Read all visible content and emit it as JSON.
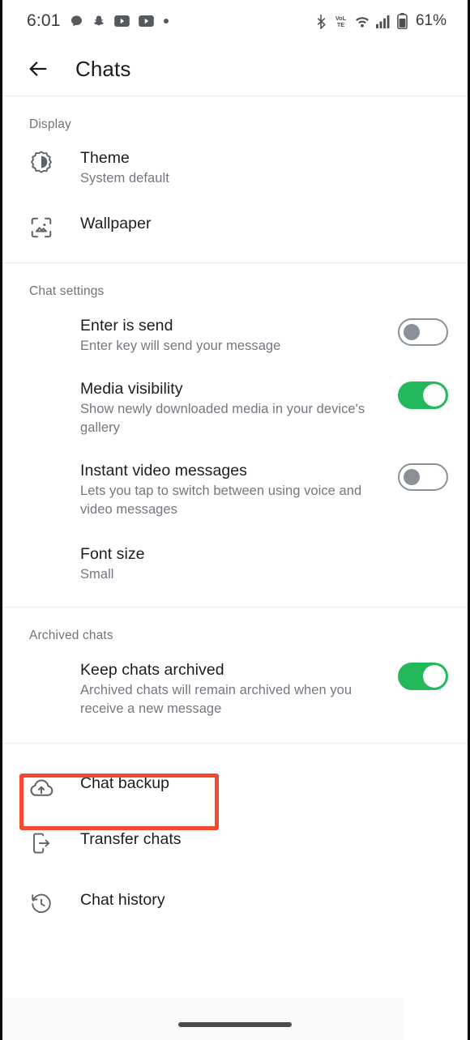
{
  "status_bar": {
    "time": "6:01",
    "battery_percent": "61%",
    "left_icons": [
      "chat-bubble-icon",
      "snapchat-icon",
      "youtube-icon",
      "youtube-icon",
      "dot-icon"
    ],
    "right_icons": [
      "bluetooth-icon",
      "volte-icon",
      "wifi-icon",
      "cellular-signal-icon",
      "battery-icon"
    ]
  },
  "app_bar": {
    "back_icon": "arrow-left-icon",
    "title": "Chats"
  },
  "colors": {
    "toggle_on": "#23b95b",
    "toggle_off": "#8b9199",
    "highlight": "#f04a32",
    "title_text": "#1d1d1d",
    "subtitle_text": "#737880",
    "section_label": "#6f7479"
  },
  "sections": [
    {
      "label": "Display",
      "rows": [
        {
          "icon": "brightness-theme-icon",
          "title": "Theme",
          "subtitle": "System default"
        },
        {
          "icon": "wallpaper-image-icon",
          "title": "Wallpaper",
          "subtitle": ""
        }
      ]
    },
    {
      "label": "Chat settings",
      "rows": [
        {
          "icon": "",
          "title": "Enter is send",
          "subtitle": "Enter key will send your message",
          "toggle": "off"
        },
        {
          "icon": "",
          "title": "Media visibility",
          "subtitle": "Show newly downloaded media in your device's gallery",
          "toggle": "on"
        },
        {
          "icon": "",
          "title": "Instant video messages",
          "subtitle": "Lets you tap to switch between using voice and video messages",
          "toggle": "off"
        },
        {
          "icon": "",
          "title": "Font size",
          "subtitle": "Small"
        }
      ]
    },
    {
      "label": "Archived chats",
      "rows": [
        {
          "icon": "",
          "title": "Keep chats archived",
          "subtitle": "Archived chats will remain archived when you receive a new message",
          "toggle": "on"
        }
      ]
    },
    {
      "label": "",
      "rows": [
        {
          "icon": "cloud-upload-icon",
          "title": "Chat backup",
          "subtitle": "",
          "highlighted": true
        },
        {
          "icon": "phone-transfer-icon",
          "title": "Transfer chats",
          "subtitle": ""
        },
        {
          "icon": "clock-history-icon",
          "title": "Chat history",
          "subtitle": ""
        }
      ]
    }
  ],
  "nav_bar": {
    "home_indicator": "home-pill-indicator"
  }
}
